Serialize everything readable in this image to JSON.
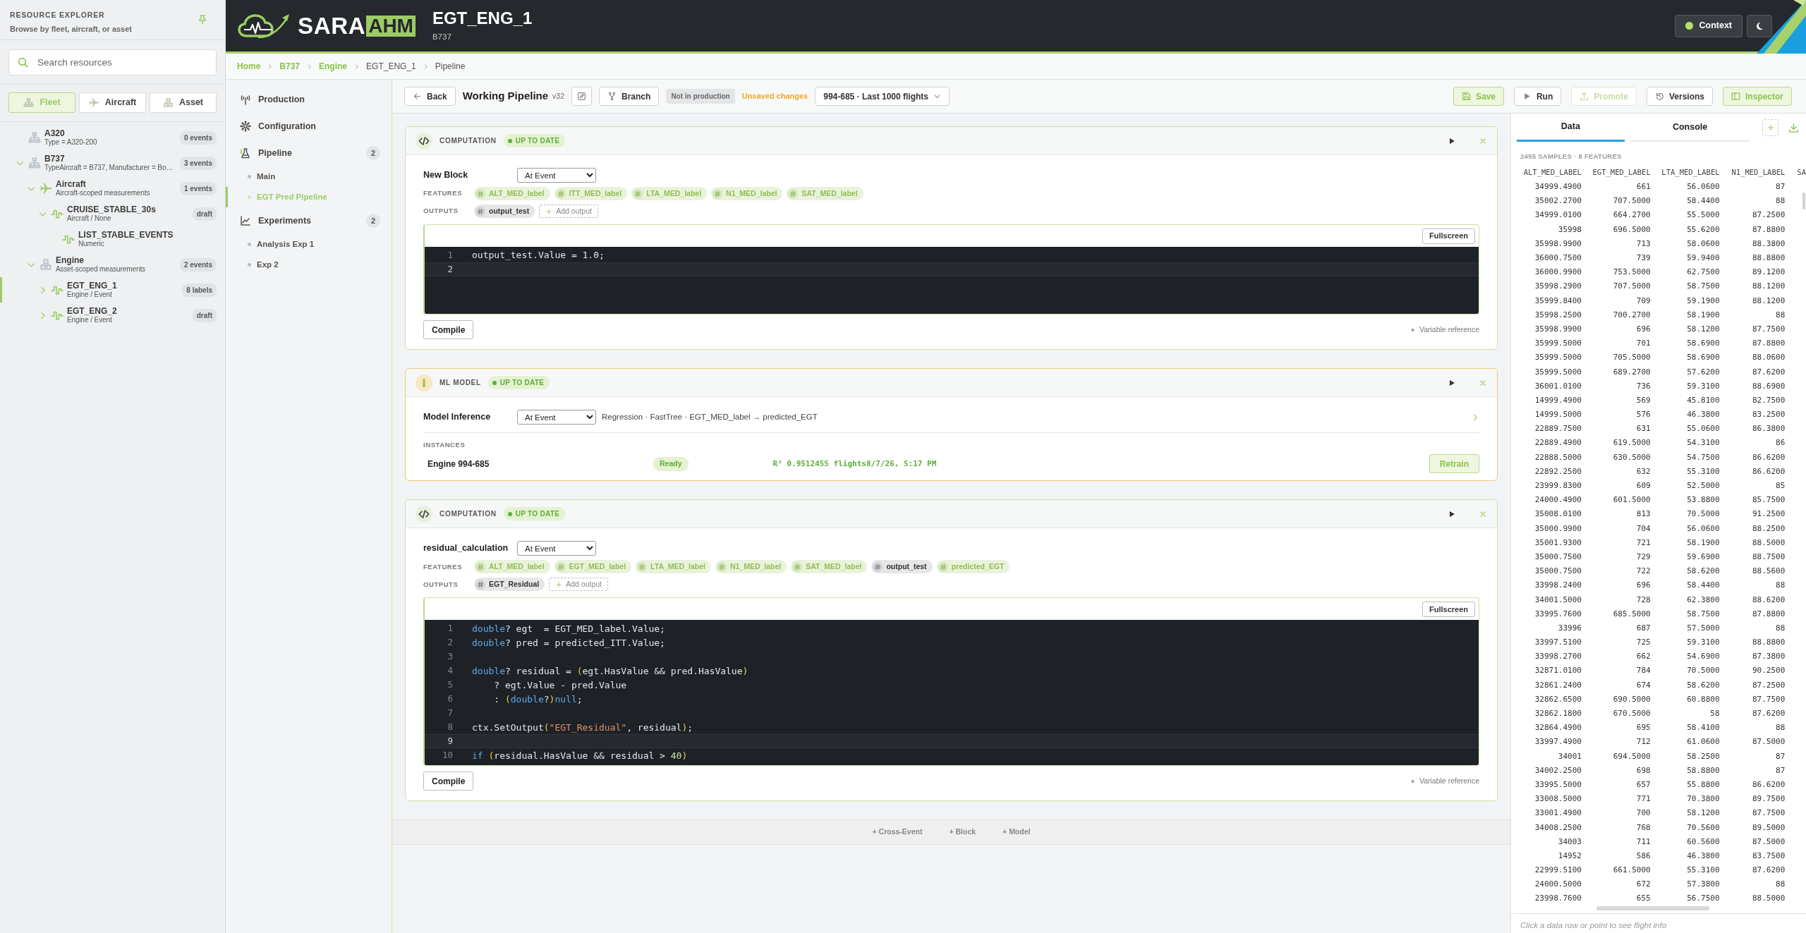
{
  "sidebar": {
    "title": "RESOURCE EXPLORER",
    "subtitle": "Browse by fleet, aircraft, or asset",
    "search": {
      "placeholder": "Search resources"
    },
    "tabs": [
      {
        "label": "Fleet",
        "kind": "fleet",
        "selected": true
      },
      {
        "label": "Aircraft",
        "kind": "aircraft",
        "selected": false
      },
      {
        "label": "Asset",
        "kind": "asset",
        "selected": false
      }
    ],
    "tree": [
      {
        "kind": "fleet",
        "title": "A320",
        "subtitle": "Type = A320-200",
        "badge": "0 events",
        "selected": false
      },
      {
        "kind": "fleet",
        "title": "B737",
        "subtitle": "TypeAircraft = B737, Manufacturer = Bo…",
        "badge": "3 events",
        "selected": false,
        "expanded": true,
        "children": [
          {
            "kind": "aircraft",
            "title": "Aircraft",
            "subtitle": "Aircraft-scoped measurements",
            "badge": "1 events",
            "selected": false,
            "expanded": true,
            "children": [
              {
                "kind": "signal",
                "title": "CRUISE_STABLE_30s",
                "subtitle": "Aircraft / None",
                "badge": "draft",
                "selected": false,
                "expanded": true,
                "children": [
                  {
                    "kind": "signal",
                    "title": "LIST_STABLE_EVENTS",
                    "subtitle": "Numeric",
                    "selected": false
                  }
                ]
              }
            ]
          },
          {
            "kind": "asset",
            "title": "Engine",
            "subtitle": "Asset-scoped measurements",
            "badge": "2 events",
            "selected": false,
            "expanded": true,
            "children": [
              {
                "kind": "signal",
                "title": "EGT_ENG_1",
                "subtitle": "Engine / Event",
                "badge": "8 labels",
                "selected": true,
                "expanded": false
              },
              {
                "kind": "signal",
                "title": "EGT_ENG_2",
                "subtitle": "Engine / Event",
                "badge": "draft",
                "selected": false,
                "expanded": false
              }
            ]
          }
        ]
      }
    ]
  },
  "header": {
    "logo": {
      "part1": "SARA",
      "part2": "AHM"
    },
    "title": "EGT_ENG_1",
    "subtitle": "B737",
    "context_button": "Context"
  },
  "breadcrumb": [
    {
      "label": "Home",
      "link": true
    },
    {
      "label": "B737",
      "link": true
    },
    {
      "label": "Engine",
      "link": true
    },
    {
      "label": "EGT_ENG_1",
      "link": false
    },
    {
      "label": "Pipeline",
      "link": false
    }
  ],
  "pipeline_nav": [
    {
      "kind": "production",
      "label": "Production"
    },
    {
      "kind": "configuration",
      "label": "Configuration"
    },
    {
      "kind": "pipeline",
      "label": "Pipeline",
      "count": "2",
      "children": [
        {
          "label": "Main",
          "selected": false
        },
        {
          "label": "EGT Pred Pipeline",
          "selected": true
        }
      ]
    },
    {
      "kind": "experiments",
      "label": "Experiments",
      "count": "2",
      "children": [
        {
          "label": "Analysis Exp 1",
          "selected": false
        },
        {
          "label": "Exp 2",
          "selected": false
        }
      ]
    }
  ],
  "toolbar": {
    "back": "Back",
    "title": "Working Pipeline",
    "version": "v32",
    "branch": "Branch",
    "production_status": "Not in production",
    "unsaved": "Unsaved changes",
    "dataset": "994-685 · Last 1000 flights",
    "actions": [
      {
        "kind": "save",
        "label": "Save",
        "accent": true,
        "disabled": false
      },
      {
        "kind": "run",
        "label": "Run",
        "accent": false,
        "disabled": false
      },
      {
        "kind": "promote",
        "label": "Promote",
        "accent": false,
        "disabled": true
      },
      {
        "kind": "versions",
        "label": "Versions",
        "accent": false,
        "disabled": false
      },
      {
        "kind": "inspector",
        "label": "Inspector",
        "accent": true,
        "disabled": false
      }
    ]
  },
  "blocks": [
    {
      "kind": "computation",
      "type_label": "COMPUTATION",
      "status": "UP TO DATE",
      "name": "New Block",
      "trigger": "At Event",
      "features_label": "FEATURES",
      "features": [
        {
          "label": "ALT_MED_label",
          "kind": "label"
        },
        {
          "label": "ITT_MED_label",
          "kind": "label"
        },
        {
          "label": "LTA_MED_label",
          "kind": "label"
        },
        {
          "label": "N1_MED_label",
          "kind": "label"
        },
        {
          "label": "SAT_MED_label",
          "kind": "label"
        }
      ],
      "outputs_label": "OUTPUTS",
      "outputs": [
        {
          "label": "output_test",
          "kind": "output"
        }
      ],
      "add_output": "Add output",
      "fullscreen": "Fullscreen",
      "code": [
        {
          "number": "1",
          "active": false,
          "tokens": [
            {
              "text": "output_test.Value = 1.0;",
              "kind": "plain"
            }
          ]
        },
        {
          "number": "2",
          "active": true
        }
      ],
      "compile": "Compile",
      "reference": "Variable reference"
    },
    {
      "kind": "model",
      "type_label": "ML MODEL",
      "status": "UP TO DATE",
      "name": "Model Inference",
      "trigger": "At Event",
      "summary": "Regression · FastTree · EGT_MED_label → predicted_EGT",
      "instances_label": "INSTANCES",
      "instances": [
        {
          "name": "Engine 994-685",
          "status": "Ready",
          "metrics": "R² 0.9512455 flights8/7/26, 5:17 PM",
          "action": "Retrain"
        }
      ]
    },
    {
      "kind": "computation",
      "type_label": "COMPUTATION",
      "status": "UP TO DATE",
      "name": "residual_calculation",
      "trigger": "At Event",
      "features_label": "FEATURES",
      "features": [
        {
          "label": "ALT_MED_label",
          "kind": "label"
        },
        {
          "label": "EGT_MED_label",
          "kind": "label"
        },
        {
          "label": "LTA_MED_label",
          "kind": "label"
        },
        {
          "label": "N1_MED_label",
          "kind": "label"
        },
        {
          "label": "SAT_MED_label",
          "kind": "label"
        },
        {
          "label": "output_test",
          "kind": "output"
        },
        {
          "label": "predicted_EGT",
          "kind": "label"
        }
      ],
      "outputs_label": "OUTPUTS",
      "outputs": [
        {
          "label": "EGT_Residual",
          "kind": "output"
        }
      ],
      "add_output": "Add output",
      "fullscreen": "Fullscreen",
      "code": [
        {
          "number": "1",
          "active": false,
          "tokens": [
            {
              "text": "double",
              "kind": "keyword"
            },
            {
              "text": "? egt  = EGT_MED_label.Value;",
              "kind": "plain"
            }
          ]
        },
        {
          "number": "2",
          "active": false,
          "tokens": [
            {
              "text": "double",
              "kind": "keyword"
            },
            {
              "text": "? pred = predicted_ITT.Value;",
              "kind": "plain"
            }
          ]
        },
        {
          "number": "3",
          "active": false
        },
        {
          "number": "4",
          "active": false,
          "tokens": [
            {
              "text": "double",
              "kind": "keyword"
            },
            {
              "text": "? residual = ",
              "kind": "plain"
            },
            {
              "text": "(",
              "kind": "paren"
            },
            {
              "text": "egt.HasValue && pred.HasValue",
              "kind": "plain"
            },
            {
              "text": ")",
              "kind": "paren"
            }
          ]
        },
        {
          "number": "5",
          "active": false,
          "tokens": [
            {
              "text": "    ? egt.Value - pred.Value",
              "kind": "plain"
            }
          ]
        },
        {
          "number": "6",
          "active": false,
          "tokens": [
            {
              "text": "    : ",
              "kind": "plain"
            },
            {
              "text": "(",
              "kind": "paren"
            },
            {
              "text": "double",
              "kind": "keyword"
            },
            {
              "text": "?",
              "kind": "plain"
            },
            {
              "text": ")",
              "kind": "paren"
            },
            {
              "text": "null",
              "kind": "keyword"
            },
            {
              "text": ";",
              "kind": "plain"
            }
          ]
        },
        {
          "number": "7",
          "active": false
        },
        {
          "number": "8",
          "active": false,
          "tokens": [
            {
              "text": "ctx.SetOutput",
              "kind": "plain"
            },
            {
              "text": "(",
              "kind": "paren"
            },
            {
              "text": "\"EGT_Residual\"",
              "kind": "string"
            },
            {
              "text": ", residual",
              "kind": "plain"
            },
            {
              "text": ")",
              "kind": "paren"
            },
            {
              "text": ";",
              "kind": "plain"
            }
          ]
        },
        {
          "number": "9",
          "active": true
        },
        {
          "number": "10",
          "active": false,
          "tokens": [
            {
              "text": "if",
              "kind": "keyword"
            },
            {
              "text": " (",
              "kind": "paren"
            },
            {
              "text": "residual.HasValue && residual > ",
              "kind": "plain"
            },
            {
              "text": "40",
              "kind": "number"
            },
            {
              "text": ")",
              "kind": "paren"
            }
          ]
        }
      ],
      "compile": "Compile",
      "reference": "Variable reference"
    }
  ],
  "add_actions": [
    "+ Cross-Event",
    "+ Block",
    "+ Model"
  ],
  "inspector": {
    "tabs": [
      {
        "label": "Data",
        "selected": true
      },
      {
        "label": "Console",
        "selected": false
      }
    ],
    "summary": "2455 SAMPLES · 8 FEATURES",
    "columns": [
      "ALT_MED_LABEL",
      "EGT_MED_LABEL",
      "LTA_MED_LABEL",
      "N1_MED_LABEL",
      "SA"
    ],
    "rows": [
      [
        "34999.4900",
        "661",
        "56.0600",
        "87"
      ],
      [
        "35002.2700",
        "707.5000",
        "58.4400",
        "88"
      ],
      [
        "34999.0100",
        "664.2700",
        "55.5000",
        "87.2500"
      ],
      [
        "35998",
        "696.5000",
        "55.6200",
        "87.8800"
      ],
      [
        "35998.9900",
        "713",
        "58.0600",
        "88.3800"
      ],
      [
        "36000.7500",
        "739",
        "59.9400",
        "88.8800"
      ],
      [
        "36000.9900",
        "753.5000",
        "62.7500",
        "89.1200"
      ],
      [
        "35998.2900",
        "707.5000",
        "58.7500",
        "88.1200"
      ],
      [
        "35999.8400",
        "709",
        "59.1900",
        "88.1200"
      ],
      [
        "35998.2500",
        "700.2700",
        "58.1900",
        "88"
      ],
      [
        "35998.9900",
        "696",
        "58.1200",
        "87.7500"
      ],
      [
        "35999.5000",
        "701",
        "58.6900",
        "87.8800"
      ],
      [
        "35999.5000",
        "705.5000",
        "58.6900",
        "88.0600"
      ],
      [
        "35999.5000",
        "689.2700",
        "57.6200",
        "87.6200"
      ],
      [
        "36001.0100",
        "736",
        "59.3100",
        "88.6900"
      ],
      [
        "14999.4900",
        "569",
        "45.8100",
        "82.7500"
      ],
      [
        "14999.5000",
        "576",
        "46.3800",
        "83.2500"
      ],
      [
        "22889.7500",
        "631",
        "55.0600",
        "86.3800"
      ],
      [
        "22889.4900",
        "619.5000",
        "54.3100",
        "86"
      ],
      [
        "22888.5000",
        "630.5000",
        "54.7500",
        "86.6200"
      ],
      [
        "22892.2500",
        "632",
        "55.3100",
        "86.6200"
      ],
      [
        "23999.8300",
        "609",
        "52.5000",
        "85"
      ],
      [
        "24000.4900",
        "601.5000",
        "53.8800",
        "85.7500"
      ],
      [
        "35008.0100",
        "813",
        "70.5000",
        "91.2500"
      ],
      [
        "35000.9900",
        "704",
        "56.0600",
        "88.2500"
      ],
      [
        "35001.9300",
        "721",
        "58.1900",
        "88.5000"
      ],
      [
        "35000.7500",
        "729",
        "59.6900",
        "88.7500"
      ],
      [
        "35000.7500",
        "722",
        "58.6200",
        "88.5600"
      ],
      [
        "33998.2400",
        "696",
        "58.4400",
        "88"
      ],
      [
        "34001.5000",
        "728",
        "62.3800",
        "88.6200"
      ],
      [
        "33995.7600",
        "685.5000",
        "58.7500",
        "87.8800"
      ],
      [
        "33996",
        "687",
        "57.5000",
        "88"
      ],
      [
        "33997.5100",
        "725",
        "59.3100",
        "88.8800"
      ],
      [
        "33998.2700",
        "662",
        "54.6900",
        "87.3800"
      ],
      [
        "32871.0100",
        "784",
        "70.5000",
        "90.2500"
      ],
      [
        "32861.2400",
        "674",
        "58.6200",
        "87.2500"
      ],
      [
        "32862.6500",
        "690.5000",
        "60.8800",
        "87.7500"
      ],
      [
        "32862.1800",
        "670.5000",
        "58",
        "87.6200"
      ],
      [
        "32864.4900",
        "695",
        "58.4100",
        "88"
      ],
      [
        "33997.4900",
        "712",
        "61.0600",
        "87.5000"
      ],
      [
        "34001",
        "694.5000",
        "58.2500",
        "87"
      ],
      [
        "34002.2500",
        "698",
        "58.8800",
        "87"
      ],
      [
        "33995.5000",
        "657",
        "55.8800",
        "86.6200"
      ],
      [
        "33008.5000",
        "771",
        "70.3800",
        "89.7500"
      ],
      [
        "33001.4900",
        "700",
        "58.1200",
        "87.7500"
      ],
      [
        "34008.2500",
        "768",
        "70.5600",
        "89.5000"
      ],
      [
        "34003",
        "711",
        "60.5600",
        "87.5000"
      ],
      [
        "14952",
        "586",
        "46.3800",
        "83.7500"
      ],
      [
        "22999.5100",
        "661.5000",
        "55.3100",
        "87.6200"
      ],
      [
        "24000.5000",
        "672",
        "57.3800",
        "88"
      ],
      [
        "23998.7600",
        "655",
        "56.7500",
        "88.5000"
      ]
    ],
    "hint": "Click a data row or point to see flight info"
  }
}
